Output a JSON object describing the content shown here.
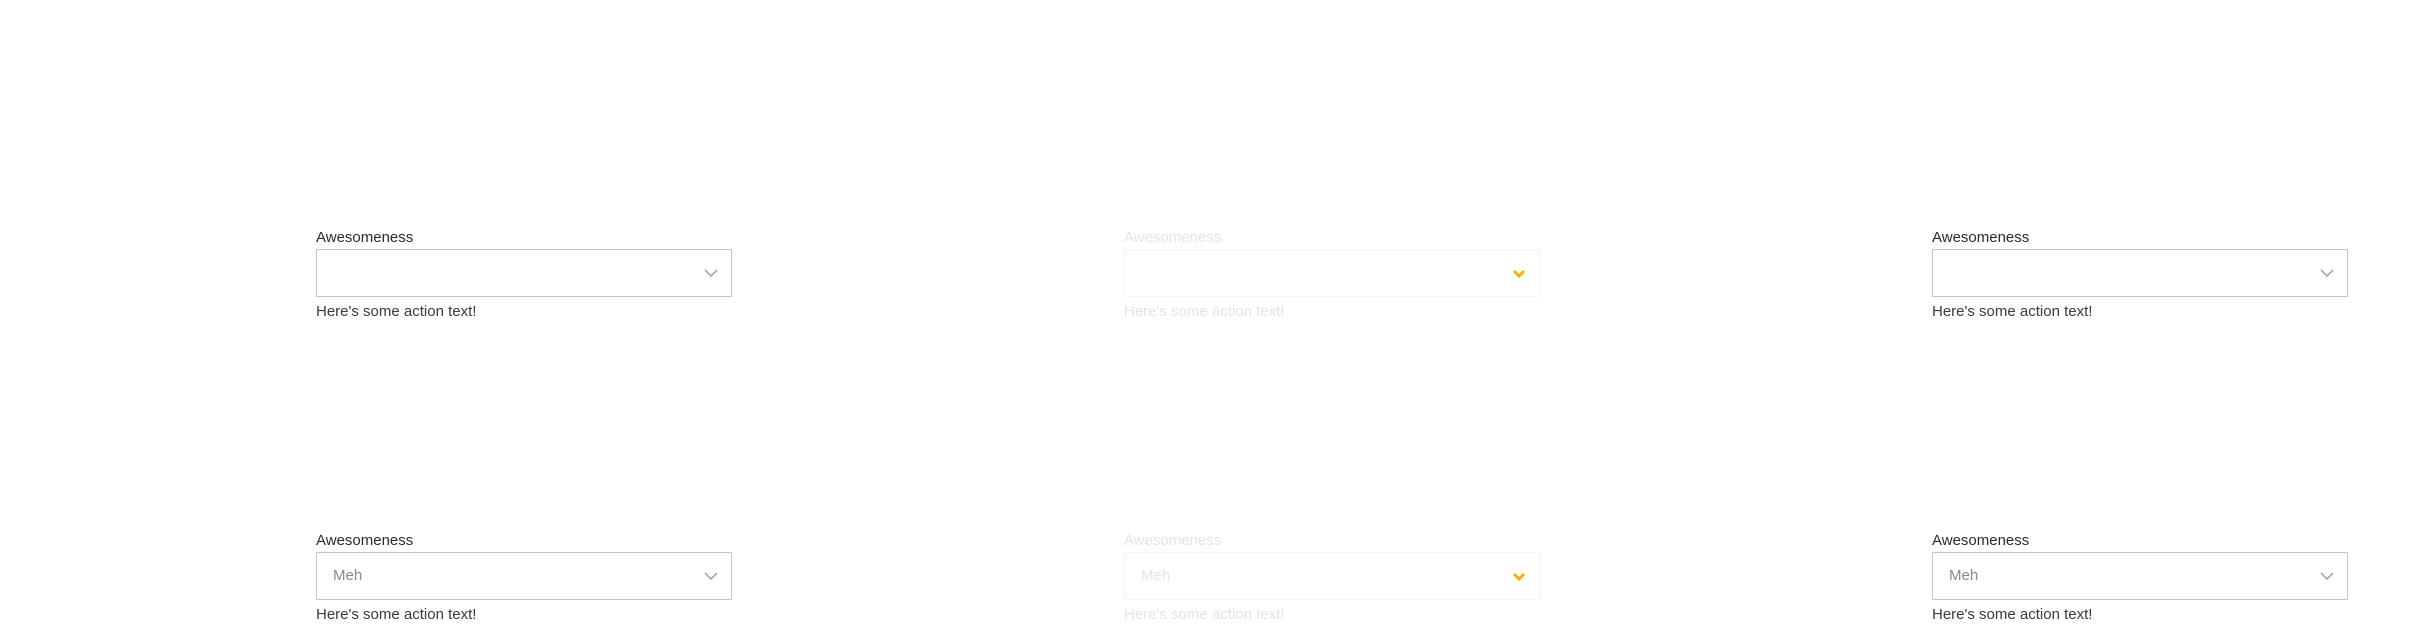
{
  "colors": {
    "label": "#2b2b2b",
    "border": "#c4c4c4",
    "chevron": "#a6a6a6",
    "chevron_active": "#f2b400",
    "placeholder": "#8a8a8a",
    "faded": "#e4e4e4"
  },
  "icons": {
    "chevron": "chevron-down-icon"
  },
  "fields": [
    {
      "label": "Awesomeness",
      "value": "",
      "action_text": "Here's some action text!",
      "state": "default"
    },
    {
      "label": "Awesomeness",
      "value": "",
      "action_text": "Here's some action text!",
      "state": "faded"
    },
    {
      "label": "Awesomeness",
      "value": "",
      "action_text": "Here's some action text!",
      "state": "default"
    },
    {
      "label": "Awesomeness",
      "value": "Meh",
      "action_text": "Here's some action text!",
      "state": "default"
    },
    {
      "label": "Awesomeness",
      "value": "Meh",
      "action_text": "Here's some action text!",
      "state": "faded"
    },
    {
      "label": "Awesomeness",
      "value": "Meh",
      "action_text": "Here's some action text!",
      "state": "default"
    }
  ]
}
